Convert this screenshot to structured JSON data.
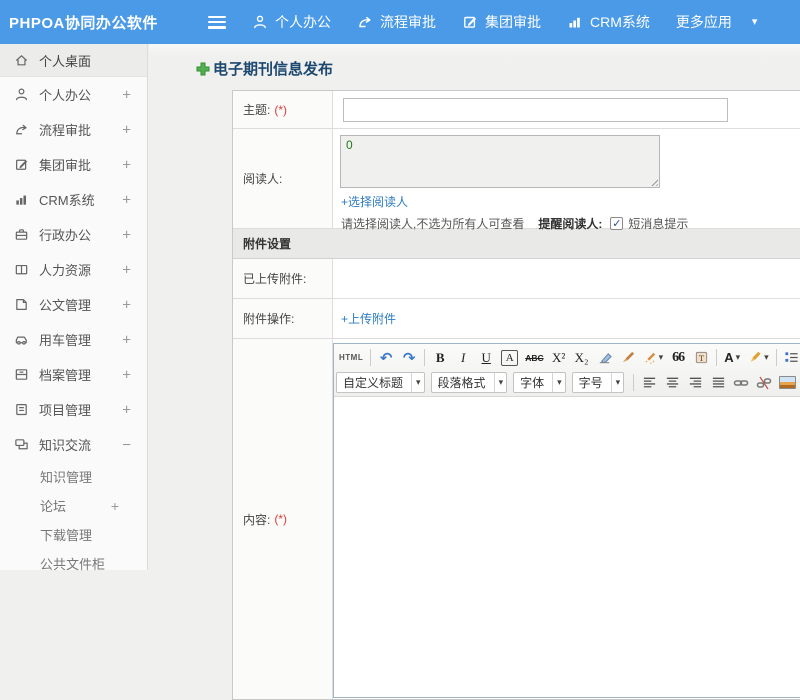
{
  "colors": {
    "header_blue": "#4a9ae8",
    "link_blue": "#2d7bc0",
    "required_red": "#e03a3a",
    "title_navy": "#1d486f",
    "plus_green": "#4aa84a"
  },
  "icons": {
    "caret_down": "▾",
    "undo": "↶",
    "redo": "↷",
    "check": "✓",
    "plus": "+",
    "minus": "−"
  },
  "header": {
    "logo": "PHPOA协同办公软件",
    "nav": [
      {
        "label": "个人办公"
      },
      {
        "label": "流程审批"
      },
      {
        "label": "集团审批"
      },
      {
        "label": "CRM系统"
      },
      {
        "label": "更多应用"
      }
    ]
  },
  "sidebar": {
    "items": [
      {
        "label": "个人桌面",
        "expand": ""
      },
      {
        "label": "个人办公",
        "expand": "+"
      },
      {
        "label": "流程审批",
        "expand": "+"
      },
      {
        "label": "集团审批",
        "expand": "+"
      },
      {
        "label": "CRM系统",
        "expand": "+"
      },
      {
        "label": "行政办公",
        "expand": "+"
      },
      {
        "label": "人力资源",
        "expand": "+"
      },
      {
        "label": "公文管理",
        "expand": "+"
      },
      {
        "label": "用车管理",
        "expand": "+"
      },
      {
        "label": "档案管理",
        "expand": "+"
      },
      {
        "label": "项目管理",
        "expand": "+"
      },
      {
        "label": "知识交流",
        "expand": "−"
      }
    ],
    "subitems": [
      {
        "label": "知识管理",
        "expand": ""
      },
      {
        "label": "论坛",
        "expand": "+"
      },
      {
        "label": "下载管理",
        "expand": ""
      },
      {
        "label": "公共文件柜",
        "expand": ""
      }
    ]
  },
  "main": {
    "page_title": "电子期刊信息发布",
    "form": {
      "subject_label": "主题:",
      "required_mark": "(*)",
      "subject_value": "",
      "readers_label": "阅读人:",
      "readers_value": "0",
      "select_readers_link": "+选择阅读人",
      "readers_note": "请选择阅读人,不选为所有人可查看",
      "remind_label": "提醒阅读人:",
      "sms_label": "短消息提示",
      "sms_checked": "✓",
      "attachment_section": "附件设置",
      "uploaded_label": "已上传附件:",
      "attach_action_label": "附件操作:",
      "upload_link": "+上传附件",
      "content_label": "内容:"
    },
    "editor": {
      "html": "HTML",
      "bold": "B",
      "italic": "I",
      "underline": "U",
      "font_box": "A",
      "strike": "ABC",
      "sup": "X²",
      "sub": "X₂",
      "quote": "66",
      "forecolor": "A",
      "selects": [
        {
          "label": "自定义标题"
        },
        {
          "label": "段落格式"
        },
        {
          "label": "字体"
        },
        {
          "label": "字号"
        }
      ]
    }
  }
}
